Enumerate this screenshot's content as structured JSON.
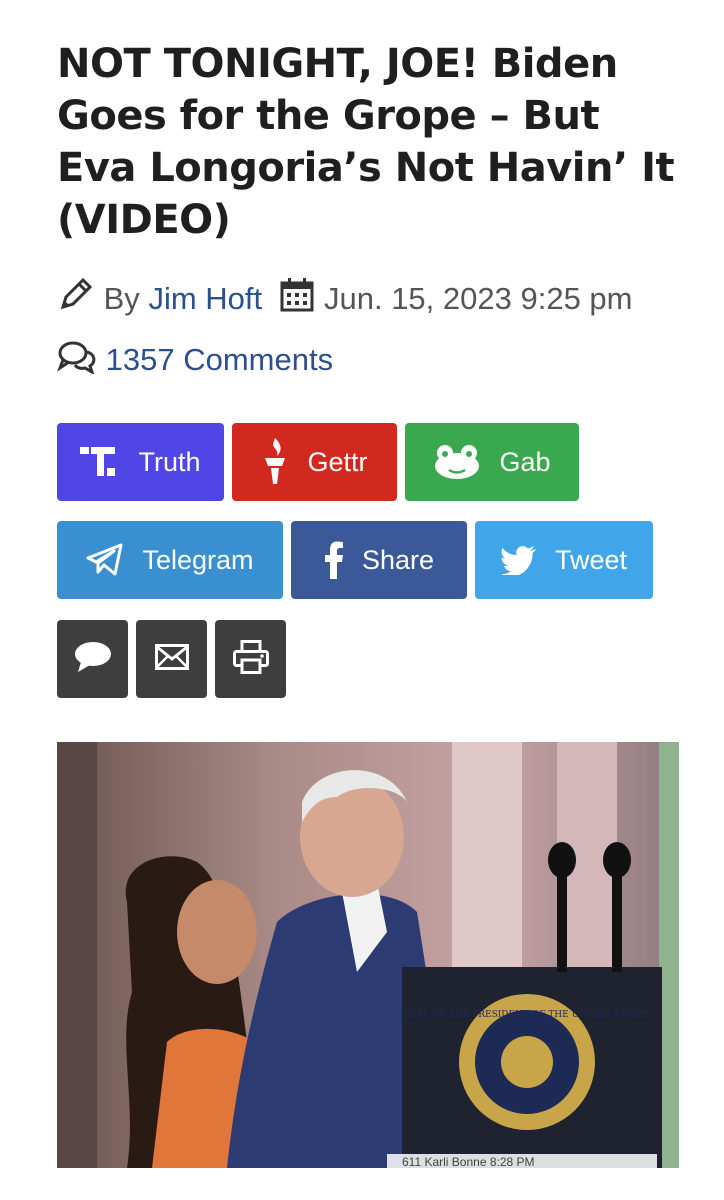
{
  "article": {
    "title": "NOT TONIGHT, JOE! Biden Goes for the Grope – But Eva Longoria’s Not Havin’ It (VIDEO)",
    "by_label": "By",
    "author": "Jim Hoft",
    "date": "Jun. 15, 2023 9:25 pm",
    "comments": "1357 Comments"
  },
  "share_buttons": [
    {
      "label": "Truth",
      "icon": "truth-social-icon",
      "color": "#4f46e5"
    },
    {
      "label": "Gettr",
      "icon": "gettr-torch-icon",
      "color": "#d1281f"
    },
    {
      "label": "Gab",
      "icon": "gab-frog-icon",
      "color": "#3aa84f"
    },
    {
      "label": "Telegram",
      "icon": "telegram-plane-icon",
      "color": "#3a8fd0"
    },
    {
      "label": "Share",
      "icon": "facebook-icon",
      "color": "#3b5998"
    },
    {
      "label": "Tweet",
      "icon": "twitter-bird-icon",
      "color": "#41a5e9"
    }
  ],
  "action_buttons": [
    {
      "icon": "comment-bubble-icon"
    },
    {
      "icon": "email-envelope-icon"
    },
    {
      "icon": "print-icon"
    }
  ],
  "image": {
    "seal_text": "SEAL OF THE PRESIDENT OF THE UNITED STATES",
    "caption_overlay": "611  Karli Bonne 8:28 PM"
  }
}
